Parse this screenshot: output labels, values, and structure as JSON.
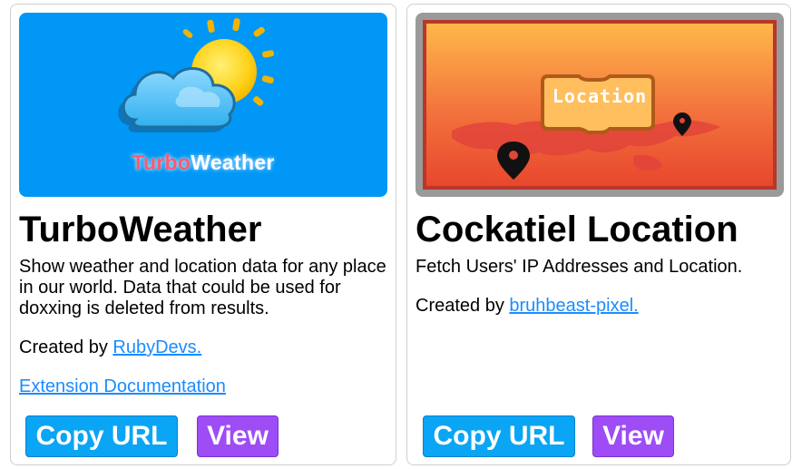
{
  "cards": [
    {
      "title": "TurboWeather",
      "description": "Show weather and location data for any place in our world. Data that could be used for doxxing is deleted from results.",
      "credit_prefix": "Created by ",
      "author": "RubyDevs.",
      "doc_link": "Extension Documentation",
      "thumbnail": {
        "brand_part_a": "Turbo",
        "brand_part_b": "Weather",
        "icons": [
          "cloud-icon",
          "sun-icon"
        ],
        "background": "#0097f6"
      },
      "copy_label": "Copy URL",
      "view_label": "View"
    },
    {
      "title": "Cockatiel Location",
      "description": "Fetch Users' IP Addresses and Location.",
      "credit_prefix": "Created by ",
      "author": "bruhbeast-pixel.",
      "thumbnail": {
        "label": "Location",
        "icons": [
          "map-pin-icon",
          "world-map-icon"
        ]
      },
      "copy_label": "Copy URL",
      "view_label": "View"
    }
  ],
  "colors": {
    "link": "#1a8cff",
    "copy_button": "#0aa5f5",
    "view_button": "#9d4cf6"
  }
}
